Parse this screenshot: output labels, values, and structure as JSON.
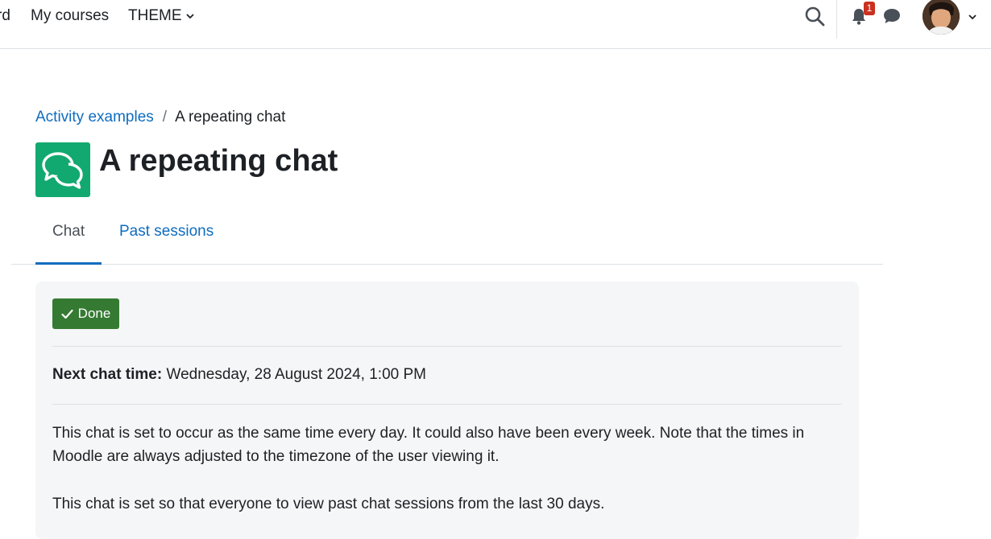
{
  "navbar": {
    "dashboard": "rd",
    "my_courses": "My courses",
    "theme": "THEME",
    "notification_count": "1"
  },
  "breadcrumb": {
    "parent": "Activity examples",
    "separator": "/",
    "current": "A repeating chat"
  },
  "page": {
    "title": "A repeating chat"
  },
  "tabs": [
    {
      "label": "Chat",
      "active": true
    },
    {
      "label": "Past sessions",
      "active": false
    }
  ],
  "content": {
    "done_label": "Done",
    "next_chat_label": "Next chat time:",
    "next_chat_value": "Wednesday, 28 August 2024, 1:00 PM",
    "paragraph_1": "This chat is set to occur as the same time every day. It could also have been every week. Note that the times in Moodle are always adjusted to the timezone of the user viewing it.",
    "paragraph_2": "This chat is set so that everyone to view past chat sessions from the last 30 days."
  },
  "colors": {
    "link": "#0f6cbf",
    "activity_icon_bg": "#12a970",
    "done_button_bg": "#357a32",
    "badge_bg": "#ca3120",
    "card_bg": "#f5f6f8"
  },
  "icons": [
    "search-icon",
    "bell-icon",
    "chat-bubble-icon",
    "chevron-down-icon",
    "check-icon",
    "chat-activity-icon"
  ]
}
